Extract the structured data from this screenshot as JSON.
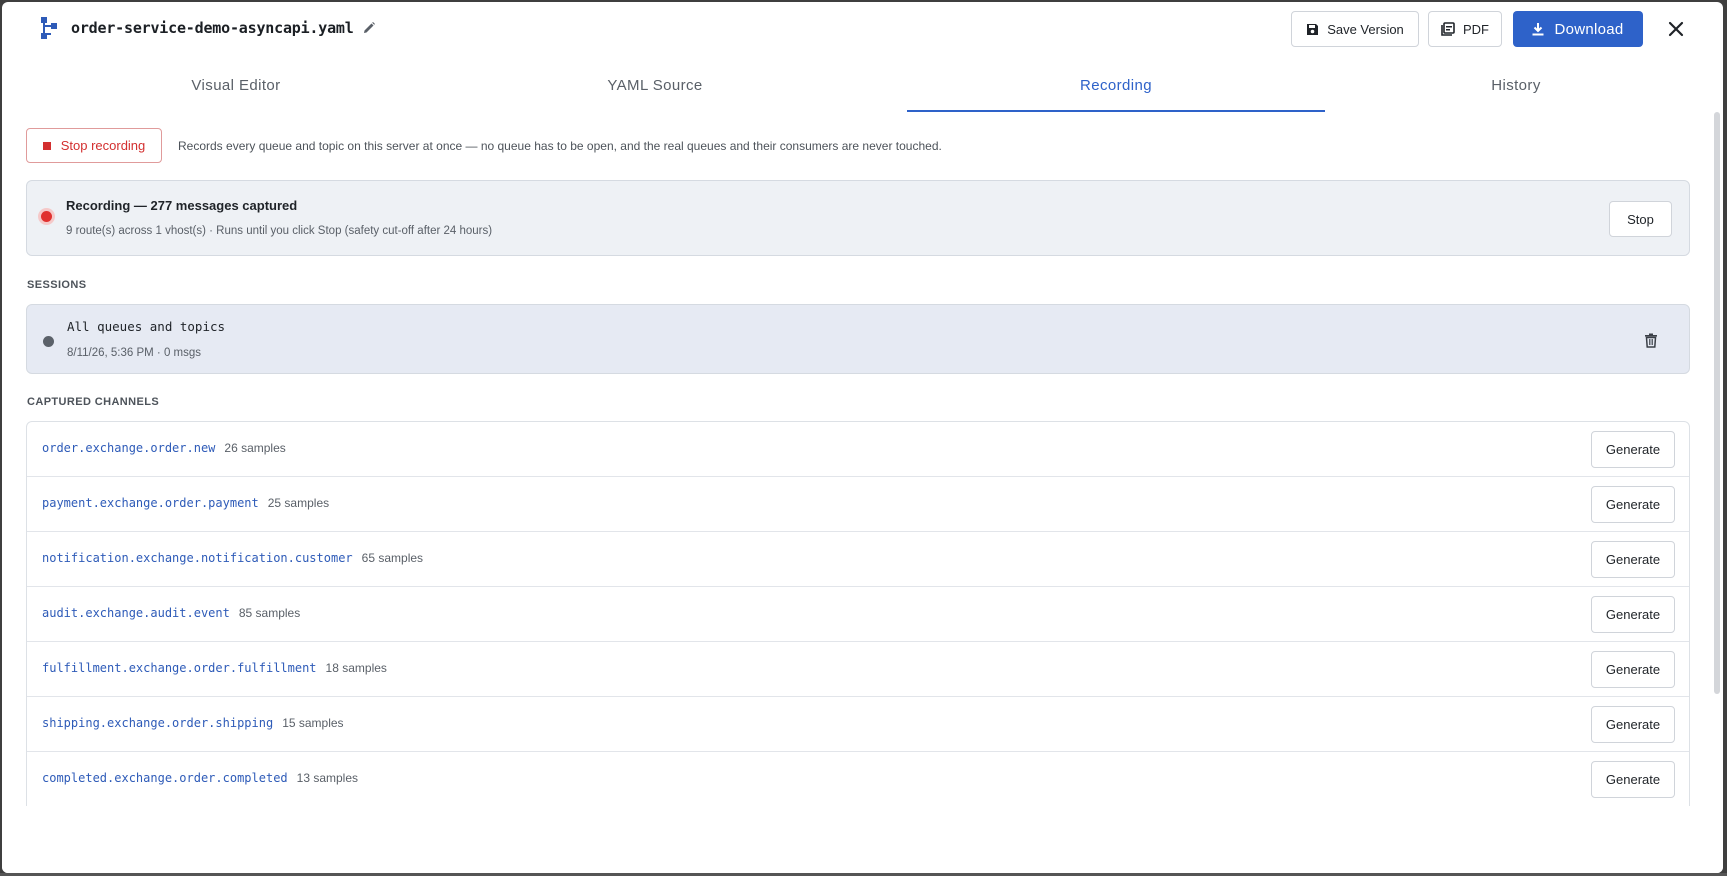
{
  "header": {
    "file_name": "order-service-demo-asyncapi.yaml",
    "save_label": "Save Version",
    "pdf_label": "PDF",
    "download_label": "Download"
  },
  "tabs": [
    {
      "label": "Visual Editor",
      "active": false
    },
    {
      "label": "YAML Source",
      "active": false
    },
    {
      "label": "Recording",
      "active": true
    },
    {
      "label": "History",
      "active": false
    }
  ],
  "recording": {
    "stop_label": "Stop recording",
    "description": "Records every queue and topic on this server at once — no queue has to be open, and the real queues and their consumers are never touched.",
    "status_title": "Recording — 277 messages captured",
    "status_sub": "9 route(s) across 1 vhost(s) · Runs until you click Stop (safety cut-off after 24 hours)",
    "stop_button": "Stop"
  },
  "sessions": {
    "heading": "SESSIONS",
    "items": [
      {
        "name": "All queues and topics",
        "meta": "8/11/26, 5:36 PM · 0 msgs"
      }
    ]
  },
  "channels": {
    "heading": "CAPTURED CHANNELS",
    "generate_label": "Generate",
    "items": [
      {
        "name": "order.exchange.order.new",
        "count": "26 samples"
      },
      {
        "name": "payment.exchange.order.payment",
        "count": "25 samples"
      },
      {
        "name": "notification.exchange.notification.customer",
        "count": "65 samples"
      },
      {
        "name": "audit.exchange.audit.event",
        "count": "85 samples"
      },
      {
        "name": "fulfillment.exchange.order.fulfillment",
        "count": "18 samples"
      },
      {
        "name": "shipping.exchange.order.shipping",
        "count": "15 samples"
      },
      {
        "name": "completed.exchange.order.completed",
        "count": "13 samples"
      }
    ]
  },
  "colors": {
    "accent": "#2e62c9",
    "recording_red": "#e0312f",
    "channel_link": "#2e5bb8"
  }
}
